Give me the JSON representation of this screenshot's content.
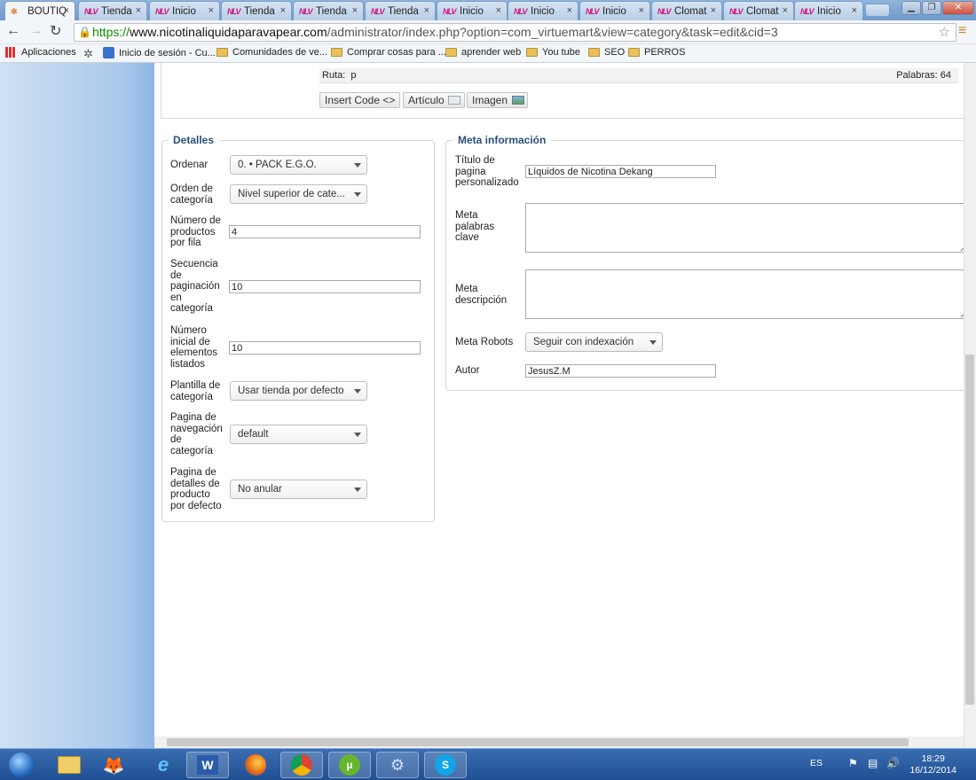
{
  "browser": {
    "tabs": [
      {
        "label": "BOUTIQ",
        "icon": "joomla-icon",
        "active": true
      },
      {
        "label": "Tienda",
        "icon": "site-favicon"
      },
      {
        "label": "Inicio",
        "icon": "site-favicon"
      },
      {
        "label": "Tienda",
        "icon": "site-favicon"
      },
      {
        "label": "Tienda",
        "icon": "site-favicon"
      },
      {
        "label": "Tienda",
        "icon": "site-favicon"
      },
      {
        "label": "Inicio",
        "icon": "site-favicon"
      },
      {
        "label": "Inicio",
        "icon": "site-favicon"
      },
      {
        "label": "Inicio",
        "icon": "site-favicon"
      },
      {
        "label": "Clomat",
        "icon": "site-favicon"
      },
      {
        "label": "Clomat",
        "icon": "site-favicon"
      },
      {
        "label": "Inicio",
        "icon": "site-favicon"
      }
    ],
    "favicon_text": "NLV",
    "close_glyph": "×",
    "url_scheme": "https://",
    "url_domain": "www.nicotinaliquidaparavapear.com",
    "url_path": "/administrator/index.php?option=com_virtuemart&view=category&task=edit&cid=3",
    "bookmarks": [
      {
        "label": "Aplicaciones",
        "icon": "apps-grid-icon"
      },
      {
        "label": "",
        "icon": "gear-icon"
      },
      {
        "label": "Inicio de sesión - Cu...",
        "icon": "favicon-icon"
      },
      {
        "label": "Comunidades de ve...",
        "icon": "folder-icon"
      },
      {
        "label": "Comprar cosas para ...",
        "icon": "folder-icon"
      },
      {
        "label": "aprender web",
        "icon": "folder-icon"
      },
      {
        "label": "You tube",
        "icon": "folder-icon"
      },
      {
        "label": "SEO",
        "icon": "folder-icon"
      },
      {
        "label": "PERROS",
        "icon": "folder-icon"
      }
    ]
  },
  "editor": {
    "ruta_label": "Ruta:",
    "ruta_value": "p",
    "palabras_label": "Palabras:",
    "palabras_value": "64",
    "buttons": {
      "insert_code": "Insert Code <>",
      "articulo": "Artículo",
      "imagen": "Imagen"
    }
  },
  "detalles": {
    "legend": "Detalles",
    "ordenar_label": "Ordenar",
    "ordenar_value": "0. • PACK E.G.O.",
    "orden_categoria_label": "Orden de categoría",
    "orden_categoria_value": "Nivel superior de cate...",
    "productos_fila_label": "Número de productos por fila",
    "productos_fila_value": "4",
    "secuencia_label": "Secuencia de paginación en categoría",
    "secuencia_value": "10",
    "numero_inicial_label": "Número inicial de elementos listados",
    "numero_inicial_value": "10",
    "plantilla_label": "Plantilla de categoría",
    "plantilla_value": "Usar tienda por defecto",
    "pagina_nav_label": "Pagina de navegación de categoría",
    "pagina_nav_value": "default",
    "pagina_detalles_label": "Pagina de detalles de producto por defecto",
    "pagina_detalles_value": "No anular"
  },
  "meta": {
    "legend": "Meta información",
    "titulo_label": "Título de pagina personalizado",
    "titulo_value": "Líquidos de Nicotina Dekang",
    "keywords_label": "Meta palabras clave",
    "keywords_value": "",
    "descripcion_label": "Meta descripción",
    "descripcion_value": "",
    "robots_label": "Meta Robots",
    "robots_value": "Seguir con indexación",
    "autor_label": "Autor",
    "autor_value": "JesusZ.M"
  },
  "taskbar": {
    "apps": [
      "start-orb-icon",
      "explorer-folder-icon",
      "gimp-icon",
      "ie-icon",
      "word-icon",
      "firefox-icon",
      "chrome-icon",
      "utorrent-icon",
      "network-app-icon",
      "skype-icon"
    ],
    "lang": "ES",
    "time": "18:29",
    "date": "16/12/2014"
  }
}
